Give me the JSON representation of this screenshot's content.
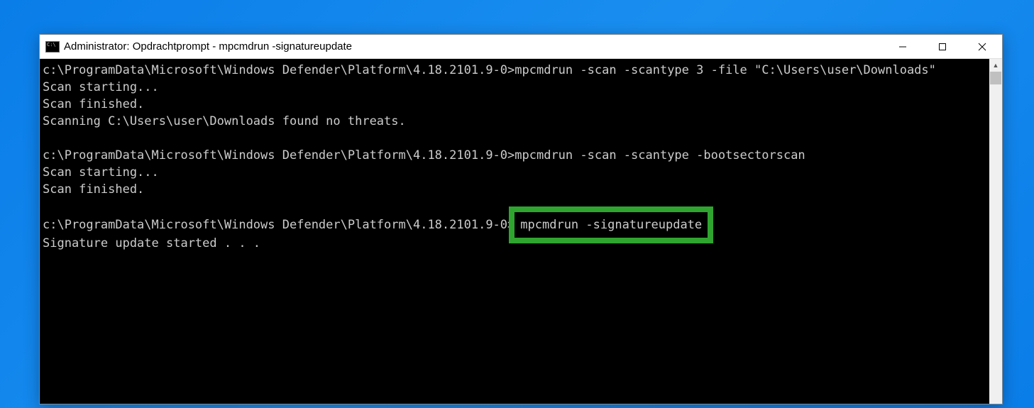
{
  "window": {
    "title": "Administrator: Opdrachtprompt - mpcmdrun  -signatureupdate"
  },
  "terminal": {
    "line1": "c:\\ProgramData\\Microsoft\\Windows Defender\\Platform\\4.18.2101.9-0>mpcmdrun -scan -scantype 3 -file \"C:\\Users\\user\\Downloads\"",
    "line2": "Scan starting...",
    "line3": "Scan finished.",
    "line4": "Scanning C:\\Users\\user\\Downloads found no threats.",
    "line5": "",
    "line6_prefix": "c:\\ProgramData\\Microsoft\\Windows Defender\\Platform\\4.18.2101.9-0>mpcmdrun -scan -scantype -bootsectorscan",
    "line7": "Scan starting...",
    "line8": "Scan finished.",
    "line9": "",
    "line10_prefix": "c:\\ProgramData\\Microsoft\\Windows Defender\\Platform\\4.18.2101.9-0>",
    "line10_highlight": "mpcmdrun -signatureupdate",
    "line11": "Signature update started . . ."
  }
}
